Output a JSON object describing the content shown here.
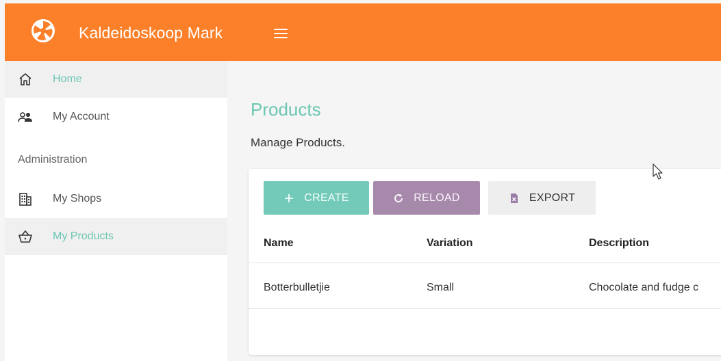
{
  "header": {
    "app_title": "Kaldeidoskoop Mark",
    "brand_color": "#fb8029",
    "logo_icon": "aperture-icon",
    "menu_icon": "hamburger-icon"
  },
  "sidebar": {
    "items": [
      {
        "label": "Home",
        "icon": "home-icon",
        "active": true
      },
      {
        "label": "My Account",
        "icon": "users-icon",
        "active": false
      },
      {
        "label": "My Shops",
        "icon": "building-icon",
        "active": false
      },
      {
        "label": "My Products",
        "icon": "basket-icon",
        "active": true
      }
    ],
    "section_label": "Administration",
    "active_color": "#6cc6b3"
  },
  "main": {
    "title": "Products",
    "subtitle": "Manage Products.",
    "toolbar": {
      "create_label": "CREATE",
      "reload_label": "RELOAD",
      "export_label": "EXPORT"
    },
    "table": {
      "columns": [
        "Name",
        "Variation",
        "Description"
      ],
      "rows": [
        [
          "Botterbulletjie",
          "Small",
          "Chocolate and fudge c"
        ]
      ]
    }
  }
}
